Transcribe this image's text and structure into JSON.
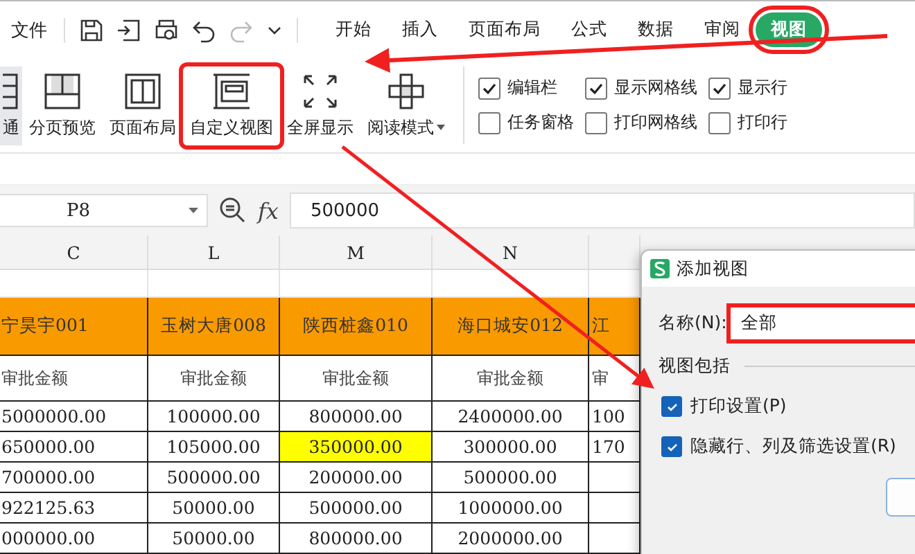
{
  "menu_bar": {
    "file_menu": "文件",
    "tabs": [
      {
        "label": "开始",
        "selected": false,
        "highlighted": false
      },
      {
        "label": "插入",
        "selected": false,
        "highlighted": false
      },
      {
        "label": "页面布局",
        "selected": false,
        "highlighted": false
      },
      {
        "label": "公式",
        "selected": false,
        "highlighted": false
      },
      {
        "label": "数据",
        "selected": false,
        "highlighted": false
      },
      {
        "label": "审阅",
        "selected": false,
        "highlighted": false
      },
      {
        "label": "视图",
        "selected": true,
        "highlighted": true
      }
    ]
  },
  "ribbon": {
    "buttons": [
      {
        "label": "通",
        "kind": "normal",
        "selected": true,
        "highlighted": false,
        "dropdown": false
      },
      {
        "label": "分页预览",
        "kind": "pagebreak",
        "selected": false,
        "highlighted": false,
        "dropdown": false
      },
      {
        "label": "页面布局",
        "kind": "layout",
        "selected": false,
        "highlighted": false,
        "dropdown": false
      },
      {
        "label": "自定义视图",
        "kind": "custom",
        "selected": false,
        "highlighted": true,
        "dropdown": false
      },
      {
        "label": "全屏显示",
        "kind": "fullscreen",
        "selected": false,
        "highlighted": false,
        "dropdown": false
      },
      {
        "label": "阅读模式",
        "kind": "reading",
        "selected": false,
        "highlighted": false,
        "dropdown": true
      }
    ],
    "options": [
      {
        "label": "编辑栏",
        "checked": true
      },
      {
        "label": "任务窗格",
        "checked": false
      },
      {
        "label": "显示网格线",
        "checked": true
      },
      {
        "label": "打印网格线",
        "checked": false
      },
      {
        "label": "显示行",
        "checked": true
      },
      {
        "label": "打印行",
        "checked": false
      }
    ]
  },
  "formula_bar": {
    "cell_reference": "P8",
    "function_label": "fx",
    "value": "500000"
  },
  "sheet": {
    "columns": [
      "C",
      "L",
      "M",
      "N"
    ],
    "rows": [
      {
        "kind": "blank",
        "cells": []
      },
      {
        "kind": "header",
        "cells": [
          {
            "text": "宁昊宇001",
            "highlighted": false
          },
          {
            "text": "玉树大唐008",
            "highlighted": false
          },
          {
            "text": "陕西桩鑫010",
            "highlighted": false
          },
          {
            "text": "海口城安012",
            "highlighted": false
          },
          {
            "text": "江",
            "highlighted": false
          }
        ]
      },
      {
        "kind": "label",
        "cells": [
          {
            "text": "审批金额",
            "highlighted": false
          },
          {
            "text": "审批金额",
            "highlighted": false
          },
          {
            "text": "审批金额",
            "highlighted": false
          },
          {
            "text": "审批金额",
            "highlighted": false
          },
          {
            "text": "审",
            "highlighted": false
          }
        ]
      },
      {
        "kind": "data",
        "cells": [
          {
            "text": "5000000.00",
            "highlighted": false
          },
          {
            "text": "100000.00",
            "highlighted": false
          },
          {
            "text": "800000.00",
            "highlighted": false
          },
          {
            "text": "2400000.00",
            "highlighted": false
          },
          {
            "text": "100",
            "highlighted": false
          }
        ]
      },
      {
        "kind": "data",
        "cells": [
          {
            "text": "650000.00",
            "highlighted": false
          },
          {
            "text": "105000.00",
            "highlighted": false
          },
          {
            "text": "350000.00",
            "highlighted": true
          },
          {
            "text": "300000.00",
            "highlighted": false
          },
          {
            "text": "170",
            "highlighted": false
          }
        ]
      },
      {
        "kind": "data",
        "cells": [
          {
            "text": "700000.00",
            "highlighted": false
          },
          {
            "text": "500000.00",
            "highlighted": false
          },
          {
            "text": "200000.00",
            "highlighted": false
          },
          {
            "text": "500000.00",
            "highlighted": false
          },
          {
            "text": "",
            "highlighted": false
          }
        ]
      },
      {
        "kind": "data",
        "cells": [
          {
            "text": "922125.63",
            "highlighted": false
          },
          {
            "text": "50000.00",
            "highlighted": false
          },
          {
            "text": "500000.00",
            "highlighted": false
          },
          {
            "text": "1000000.00",
            "highlighted": false
          },
          {
            "text": "",
            "highlighted": false
          }
        ]
      },
      {
        "kind": "data",
        "cells": [
          {
            "text": "000000.00",
            "highlighted": false
          },
          {
            "text": "50000.00",
            "highlighted": false
          },
          {
            "text": "800000.00",
            "highlighted": false
          },
          {
            "text": "2000000.00",
            "highlighted": false
          },
          {
            "text": "",
            "highlighted": false
          }
        ]
      }
    ]
  },
  "dialog": {
    "title": "添加视图",
    "name_label": "名称(N):",
    "name_value": "全部",
    "name_highlighted": true,
    "group_label": "视图包括",
    "options": [
      {
        "label": "打印设置(P)",
        "checked": true
      },
      {
        "label": "隐藏行、列及筛选设置(R)",
        "checked": true
      }
    ]
  }
}
